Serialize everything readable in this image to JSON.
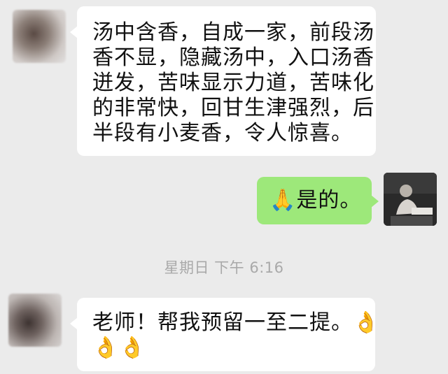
{
  "messages": [
    {
      "side": "left",
      "lines": [
        "汤中含香，自成一家，前段汤",
        "香不显，隐藏汤中，入口汤香",
        "迸发，苦味显示力道，苦味化",
        "的非常快，回甘生津强烈，后",
        "半段有小麦香，令人惊喜。"
      ]
    },
    {
      "side": "right",
      "text": "🙏是的。"
    },
    {
      "side": "left",
      "lines": [
        "老师！帮我预留一至二提。👌",
        "👌👌"
      ]
    }
  ],
  "timestamp": "星期日 下午 6:16",
  "colors": {
    "background": "#ebebeb",
    "bubble_left": "#ffffff",
    "bubble_right": "#9de87a",
    "timestamp_text": "#a9a9a9"
  },
  "icons": {
    "avatar_left": "blurred-contact-avatar",
    "avatar_right": "user-photo-avatar"
  }
}
